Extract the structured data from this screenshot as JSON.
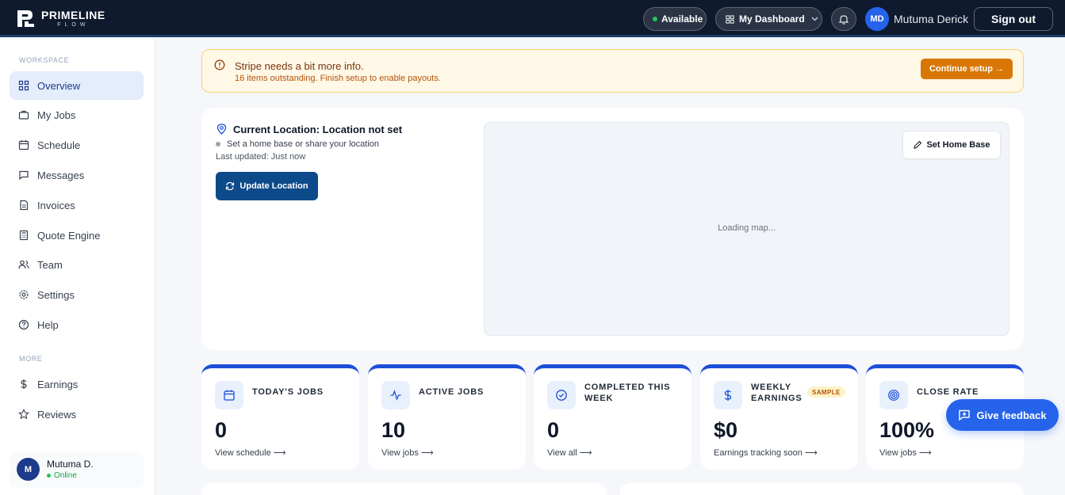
{
  "brand": {
    "line1": "PRIMELINE",
    "line2": "FLOW"
  },
  "topbar": {
    "status_label": "Available",
    "dashboard_label": "My Dashboard",
    "user_initials": "MD",
    "user_name": "Mutuma Derick",
    "signout_label": "Sign out"
  },
  "sidebar": {
    "workspace_label": "WORKSPACE",
    "items": [
      {
        "label": "Overview",
        "icon": "grid-icon"
      },
      {
        "label": "My Jobs",
        "icon": "briefcase-icon"
      },
      {
        "label": "Schedule",
        "icon": "calendar-icon"
      },
      {
        "label": "Messages",
        "icon": "message-icon"
      },
      {
        "label": "Invoices",
        "icon": "document-icon"
      },
      {
        "label": "Quote Engine",
        "icon": "calculator-icon"
      },
      {
        "label": "Team",
        "icon": "users-icon"
      },
      {
        "label": "Settings",
        "icon": "gear-icon"
      },
      {
        "label": "Help",
        "icon": "help-icon"
      }
    ],
    "more_label": "MORE",
    "more_items": [
      {
        "label": "Earnings",
        "icon": "dollar-icon"
      },
      {
        "label": "Reviews",
        "icon": "star-icon"
      }
    ],
    "user": {
      "initial": "M",
      "name": "Mutuma D.",
      "status": "Online"
    }
  },
  "alert": {
    "title": "Stripe needs a bit more info.",
    "subtitle": "16 items outstanding. Finish setup to enable payouts.",
    "button": "Continue setup →"
  },
  "location": {
    "title": "Current Location: Location not set",
    "subtitle": "Set a home base or share your location",
    "last_updated": "Last updated: Just now",
    "update_button": "Update Location",
    "home_button": "Set Home Base",
    "map_loading": "Loading map..."
  },
  "stats": [
    {
      "label": "TODAY'S JOBS",
      "value": "0",
      "link": "View schedule ⟶"
    },
    {
      "label": "ACTIVE JOBS",
      "value": "10",
      "link": "View jobs ⟶"
    },
    {
      "label": "COMPLETED THIS WEEK",
      "value": "0",
      "link": "View all ⟶"
    },
    {
      "label": "WEEKLY EARNINGS",
      "badge": "SAMPLE",
      "value": "$0",
      "link": "Earnings tracking soon ⟶"
    },
    {
      "label": "CLOSE RATE",
      "value": "100%",
      "link": "View jobs ⟶"
    }
  ],
  "feedback_button": "Give feedback",
  "colors": {
    "accent": "#1d4ed8",
    "topbar": "#0f1a2e",
    "warning": "#d97706"
  }
}
